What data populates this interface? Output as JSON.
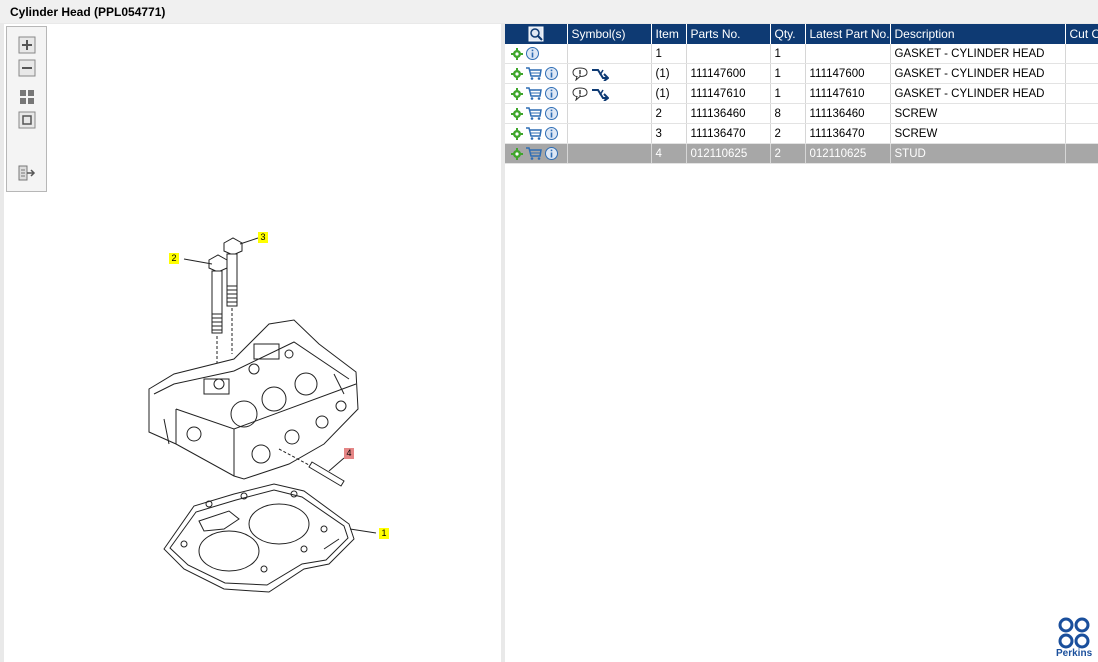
{
  "window": {
    "title": "Cylinder Head (PPL054771)"
  },
  "toolbar": {
    "zoom_in": "zoom-in-icon",
    "zoom_out": "zoom-out-icon",
    "fit": "fit-to-window-icon",
    "actual": "actual-size-icon",
    "export": "export-icon"
  },
  "diagram": {
    "callouts": [
      {
        "label": "1",
        "color": "#ffff00"
      },
      {
        "label": "2",
        "color": "#ffff00"
      },
      {
        "label": "3",
        "color": "#ffff00"
      },
      {
        "label": "4",
        "color": "#e58686"
      }
    ]
  },
  "table": {
    "columns": [
      "",
      "Symbol(s)",
      "Item",
      "Parts No.",
      "Qty.",
      "Latest Part No.",
      "Description",
      "Cut O"
    ],
    "rows": [
      {
        "item": "1",
        "parts_no": "",
        "qty": "1",
        "latest": "",
        "description": "GASKET - CYLINDER HEAD",
        "cart": false,
        "symbols": false,
        "selected": false
      },
      {
        "item": "(1)",
        "parts_no": "111147600",
        "qty": "1",
        "latest": "111147600",
        "description": "GASKET - CYLINDER HEAD",
        "cart": true,
        "symbols": true,
        "selected": false
      },
      {
        "item": "(1)",
        "parts_no": "111147610",
        "qty": "1",
        "latest": "111147610",
        "description": "GASKET - CYLINDER HEAD",
        "cart": true,
        "symbols": true,
        "selected": false
      },
      {
        "item": "2",
        "parts_no": "111136460",
        "qty": "8",
        "latest": "111136460",
        "description": "SCREW",
        "cart": true,
        "symbols": false,
        "selected": false
      },
      {
        "item": "3",
        "parts_no": "111136470",
        "qty": "2",
        "latest": "111136470",
        "description": "SCREW",
        "cart": true,
        "symbols": false,
        "selected": false
      },
      {
        "item": "4",
        "parts_no": "012110625",
        "qty": "2",
        "latest": "012110625",
        "description": "STUD",
        "cart": true,
        "symbols": false,
        "selected": true
      }
    ]
  },
  "brand": {
    "name": "Perkins",
    "color": "#1a4f9c"
  },
  "colors": {
    "header": "#0e3a73",
    "selected": "#a7a7a7"
  }
}
